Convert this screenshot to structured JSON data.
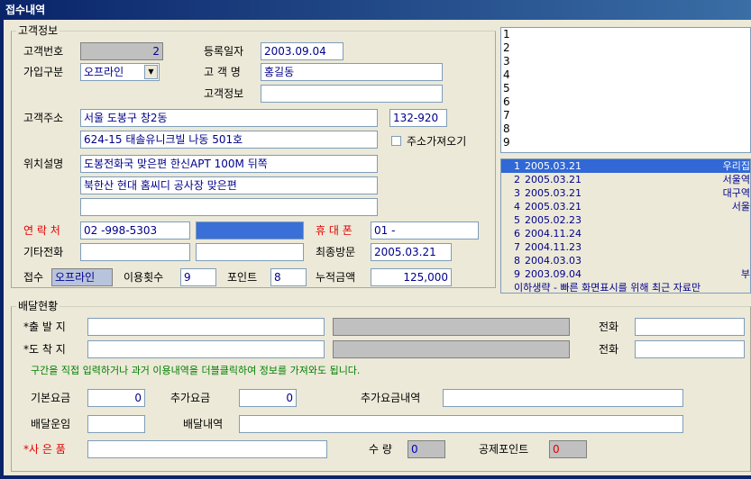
{
  "window": {
    "title": "접수내역"
  },
  "customer": {
    "group_label": "고객정보",
    "no_label": "고객번호",
    "no_value": "2",
    "regdate_label": "등록일자",
    "regdate_value": "2003.09.04",
    "join_label": "가입구분",
    "join_value": "오프라인",
    "name_label": "고 객 명",
    "name_value": "홍길동",
    "info_label": "고객정보",
    "info_value": "",
    "addr_label": "고객주소",
    "addr1_value": "서울 도봉구 창2동",
    "addr2_value": "624-15 태솔유니크빌 나동 501호",
    "zip_value": "132-920",
    "fetch_addr_label": "주소가져오기",
    "loc_label": "위치설명",
    "loc1_value": "도봉전화국 맞은편 한신APT 100M 뒤쪽",
    "loc2_value": "북한산 현대 홈씨디 공사장 맞은편",
    "loc3_value": "",
    "contact_label": "연 락 처",
    "contact_value": "02  -998-5303",
    "contact2_value": "",
    "mobile_label": "휴 대 폰",
    "mobile_value": "01 -",
    "other_phone_label": "기타전화",
    "other_phone_value": "",
    "other_phone2_value": "",
    "lastvisit_label": "최종방문",
    "lastvisit_value": "2005.03.21",
    "receipt_label": "접수",
    "receipt_value": "오프라인",
    "usecount_label": "이용횟수",
    "usecount_value": "9",
    "point_label": "포인트",
    "point_value": "8",
    "total_label": "누적금액",
    "total_value": "125,000"
  },
  "memo_lines": [
    "1",
    "2",
    "3",
    "4",
    "5",
    "6",
    "7",
    "8",
    "9"
  ],
  "history": {
    "rows": [
      {
        "n": "1",
        "date": "2005.03.21",
        "place": "우리집",
        "selected": true
      },
      {
        "n": "2",
        "date": "2005.03.21",
        "place": "서울역",
        "selected": false
      },
      {
        "n": "3",
        "date": "2005.03.21",
        "place": "대구역",
        "selected": false
      },
      {
        "n": "4",
        "date": "2005.03.21",
        "place": "서울",
        "selected": false
      },
      {
        "n": "5",
        "date": "2005.02.23",
        "place": "",
        "selected": false
      },
      {
        "n": "6",
        "date": "2004.11.24",
        "place": "",
        "selected": false
      },
      {
        "n": "7",
        "date": "2004.11.23",
        "place": "",
        "selected": false
      },
      {
        "n": "8",
        "date": "2004.03.03",
        "place": "",
        "selected": false
      },
      {
        "n": "9",
        "date": "2003.09.04",
        "place": "부",
        "selected": false
      }
    ],
    "note": "이하생략 - 빠른 화면표시를 위해 최근 자료만"
  },
  "delivery": {
    "group_label": "배달현황",
    "origin_label": "*출 발 지",
    "origin_value": "",
    "origin_area": "",
    "dest_label": "*도 착 지",
    "dest_value": "",
    "dest_area": "",
    "phone_label": "전화",
    "phone1_value": "",
    "phone2_value": "",
    "hint": "구간을 직접 입력하거나 과거 이용내역을 더블클릭하여 정보를 가져와도 됩니다.",
    "base_fee_label": "기본요금",
    "base_fee_value": "0",
    "extra_fee_label": "추가요금",
    "extra_fee_value": "0",
    "extra_detail_label": "추가요금내역",
    "extra_detail_value": "",
    "fare_label": "배달운임",
    "fare_value": "",
    "detail_label": "배달내역",
    "detail_value": "",
    "gift_label": "*사 은 품",
    "gift_value": "",
    "qty_label": "수 량",
    "qty_value": "0",
    "deduct_label": "공제포인트",
    "deduct_value": "0"
  }
}
